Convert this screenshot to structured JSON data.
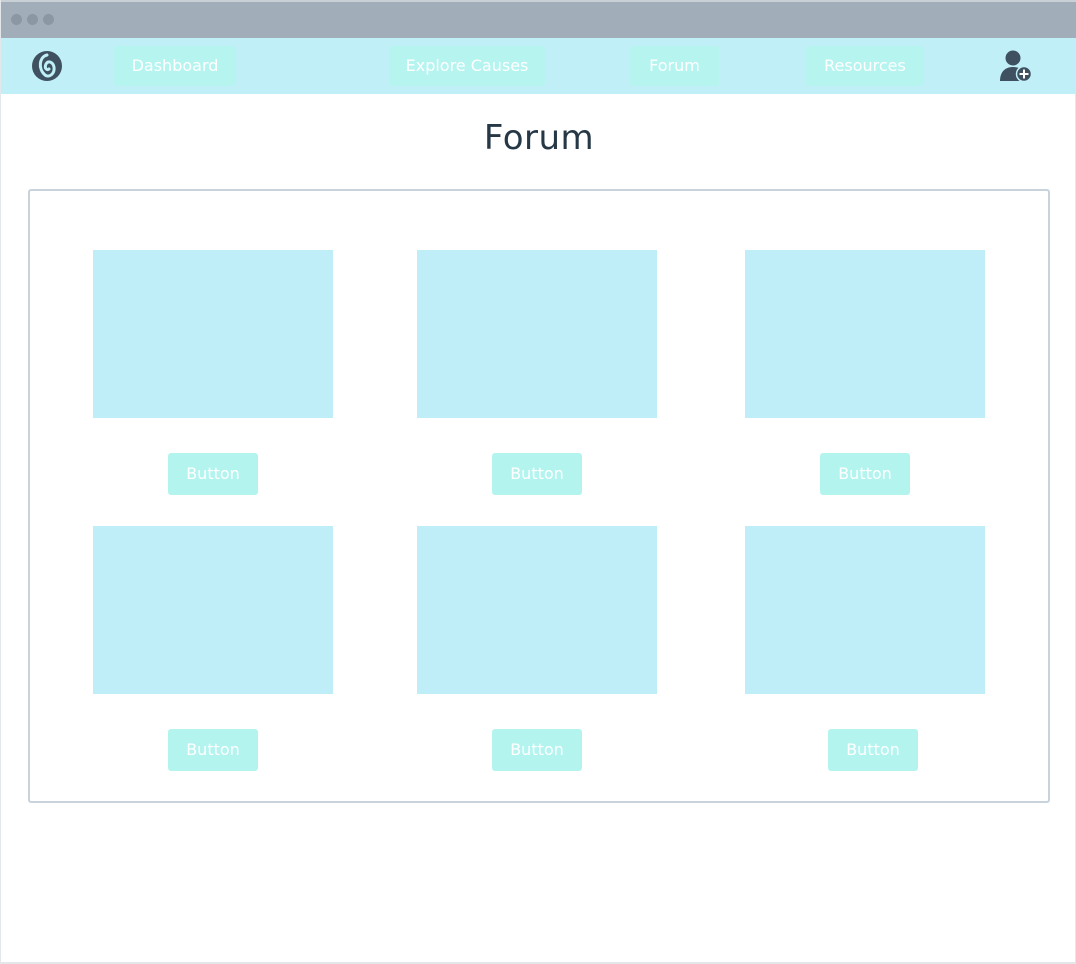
{
  "navbar": {
    "items": [
      {
        "label": "Dashboard"
      },
      {
        "label": "Explore Causes"
      },
      {
        "label": "Forum"
      },
      {
        "label": "Resources"
      }
    ]
  },
  "page": {
    "title": "Forum"
  },
  "cards": [
    {
      "button_label": "Button"
    },
    {
      "button_label": "Button"
    },
    {
      "button_label": "Button"
    },
    {
      "button_label": "Button"
    },
    {
      "button_label": "Button"
    },
    {
      "button_label": "Button"
    }
  ],
  "icons": {
    "logo": "logo-swirl-icon",
    "user": "add-user-icon"
  },
  "colors": {
    "titlebar": "#a1adb9",
    "navbar": "#c0eff8",
    "button": "#b6f4f0",
    "placeholder": "#bfeef9",
    "title_text": "#263746",
    "icon": "#3f5160"
  }
}
